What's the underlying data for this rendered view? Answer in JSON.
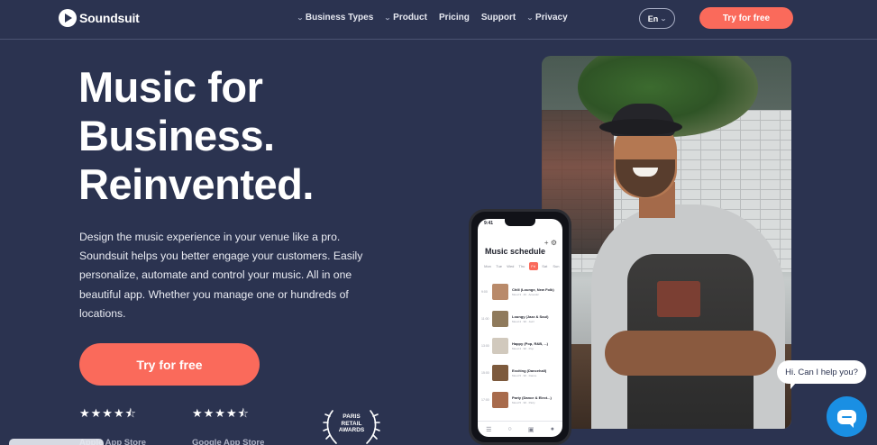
{
  "nav": {
    "brand": "Soundsuit",
    "links": [
      {
        "label": "Business Types",
        "dropdown": true
      },
      {
        "label": "Product",
        "dropdown": true
      },
      {
        "label": "Pricing",
        "dropdown": false
      },
      {
        "label": "Support",
        "dropdown": false
      },
      {
        "label": "Privacy",
        "dropdown": true
      }
    ],
    "language": "En",
    "cta_label": "Try for free"
  },
  "hero": {
    "headline_line1": "Music for",
    "headline_line2": "Business.",
    "headline_line3": "Reinvented.",
    "lead": "Design the music experience in your venue like a pro. Soundsuit helps you better engage your customers. Easily personalize, automate and control your music. All in one beautiful app. Whether you manage one or hundreds of locations.",
    "cta_label": "Try for free",
    "ratings": [
      {
        "stars": "★★★★⯪",
        "label": "Apple App Store"
      },
      {
        "stars": "★★★★⯪",
        "label": "Google App Store"
      }
    ],
    "award": {
      "line1": "PARIS",
      "line2": "RETAIL",
      "line3": "AWARDS"
    }
  },
  "phone": {
    "status_time": "9:41",
    "title": "Music schedule",
    "days": [
      "Mon",
      "Tue",
      "Wed",
      "Thu",
      "Fri",
      "Sat",
      "Sun"
    ],
    "active_day_index": 4,
    "schedule": [
      {
        "time": "9:00",
        "title": "Chill (Lounge, New Folk)",
        "sub": "Mood 3 · 40 · Acoustic",
        "color": "#b98a6a"
      },
      {
        "time": "11:00",
        "title": "Loungy (Jazz & Soul)",
        "sub": "Mood 4 · 90 · Jazz",
        "color": "#8f7a5c"
      },
      {
        "time": "13:00",
        "title": "Happy (Pop, R&B, ...)",
        "sub": "Mood 4 · 90 · Pop",
        "color": "#d1c9bd"
      },
      {
        "time": "15:00",
        "title": "Exciting (Dancehall)",
        "sub": "Mood 5 · 90 · Dance",
        "color": "#7d5a3d"
      },
      {
        "time": "17:00",
        "title": "Party (Dance & Elect...)",
        "sub": "Mood 5 · 90 · Party",
        "color": "#a86b4c"
      }
    ]
  },
  "chat": {
    "bubble_text": "Hi. Can I help you?"
  },
  "colors": {
    "background": "#2b3350",
    "accent": "#fa6a5b",
    "chat": "#1a8fe3"
  }
}
